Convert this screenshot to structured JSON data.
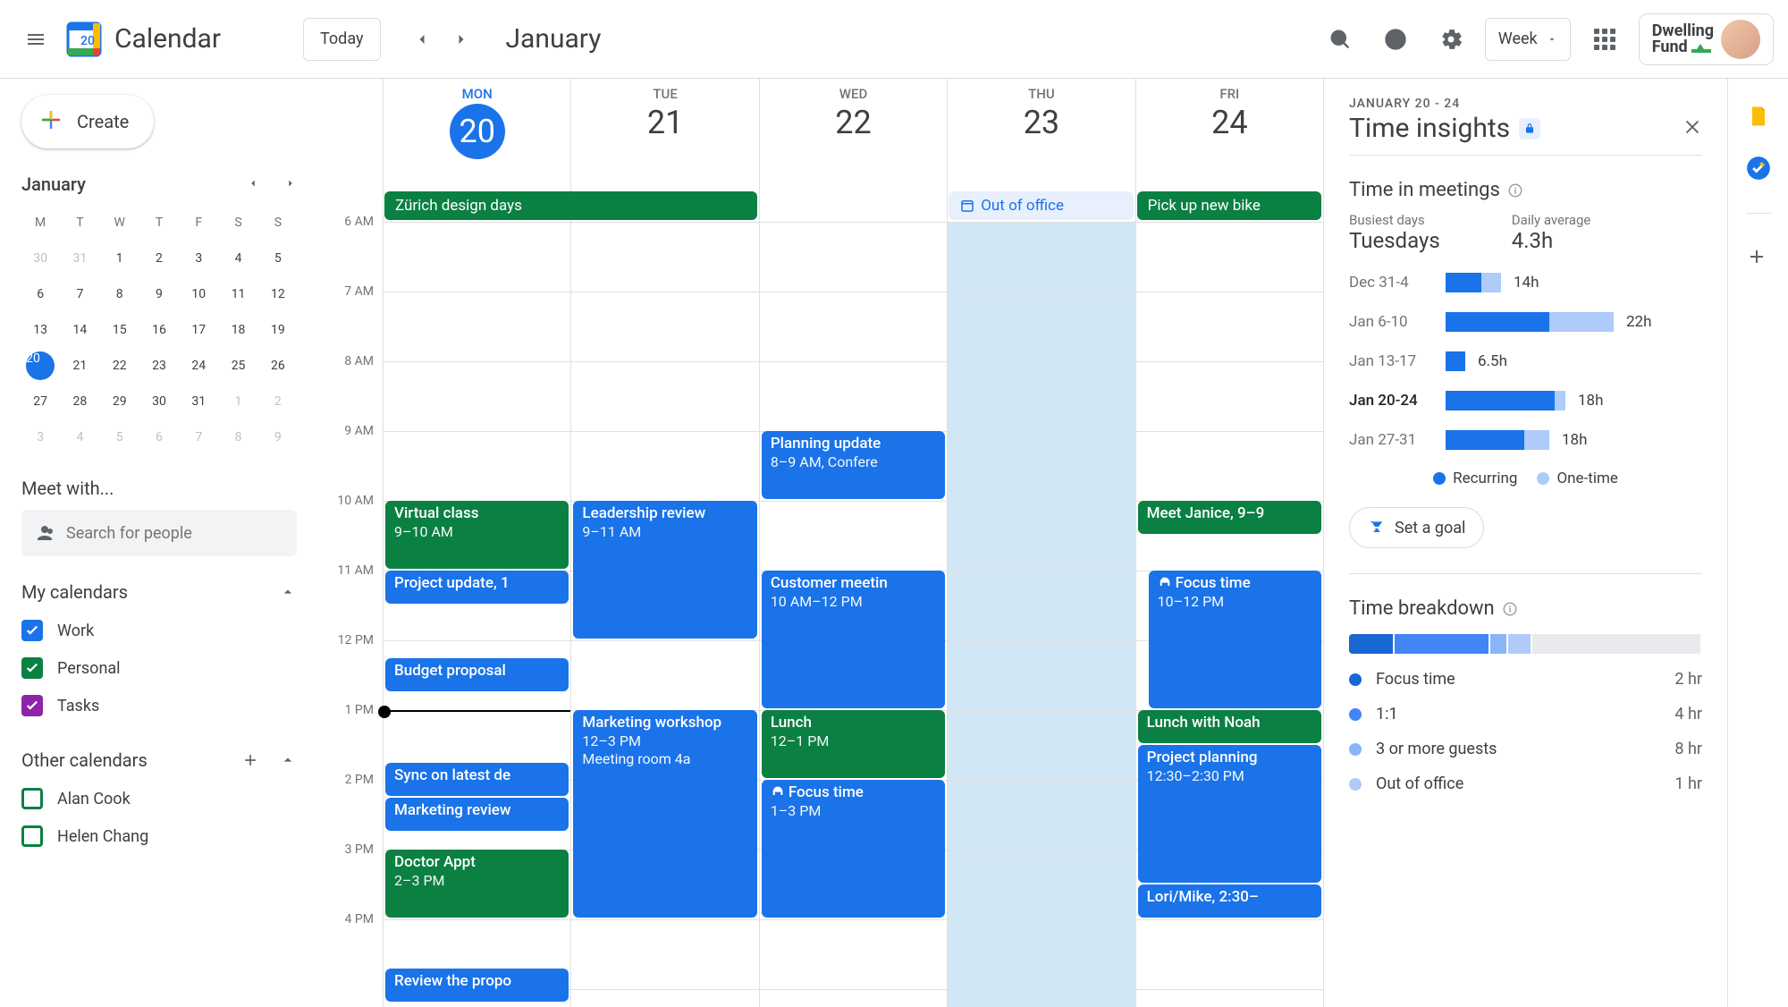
{
  "app": {
    "title": "Calendar"
  },
  "header": {
    "today_label": "Today",
    "month_title": "January",
    "view": "Week",
    "org": "Dwelling\nFund"
  },
  "create_label": "Create",
  "mini_calendar": {
    "month": "January",
    "dow": [
      "M",
      "T",
      "W",
      "T",
      "F",
      "S",
      "S"
    ],
    "weeks": [
      [
        {
          "n": 30,
          "other": true
        },
        {
          "n": 31,
          "other": true
        },
        {
          "n": 1
        },
        {
          "n": 2
        },
        {
          "n": 3
        },
        {
          "n": 4
        },
        {
          "n": 5
        }
      ],
      [
        {
          "n": 6
        },
        {
          "n": 7
        },
        {
          "n": 8
        },
        {
          "n": 9
        },
        {
          "n": 10
        },
        {
          "n": 11
        },
        {
          "n": 12
        }
      ],
      [
        {
          "n": 13
        },
        {
          "n": 14
        },
        {
          "n": 15
        },
        {
          "n": 16
        },
        {
          "n": 17
        },
        {
          "n": 18
        },
        {
          "n": 19
        }
      ],
      [
        {
          "n": 20,
          "selected": true
        },
        {
          "n": 21
        },
        {
          "n": 22
        },
        {
          "n": 23
        },
        {
          "n": 24
        },
        {
          "n": 25
        },
        {
          "n": 26
        }
      ],
      [
        {
          "n": 27
        },
        {
          "n": 28
        },
        {
          "n": 29
        },
        {
          "n": 30
        },
        {
          "n": 31
        },
        {
          "n": 1,
          "other": true
        },
        {
          "n": 2,
          "other": true
        }
      ],
      [
        {
          "n": 3,
          "other": true
        },
        {
          "n": 4,
          "other": true
        },
        {
          "n": 5,
          "other": true
        },
        {
          "n": 6,
          "other": true
        },
        {
          "n": 7,
          "other": true
        },
        {
          "n": 8,
          "other": true
        },
        {
          "n": 9,
          "other": true
        }
      ]
    ]
  },
  "meet_with": {
    "title": "Meet with...",
    "placeholder": "Search for people"
  },
  "my_calendars": {
    "title": "My calendars",
    "items": [
      {
        "label": "Work",
        "color": "#1a73e8",
        "checked": true
      },
      {
        "label": "Personal",
        "color": "#0b8043",
        "checked": true
      },
      {
        "label": "Tasks",
        "color": "#8e24aa",
        "checked": true
      }
    ]
  },
  "other_calendars": {
    "title": "Other calendars",
    "items": [
      {
        "label": "Alan Cook",
        "color": "#0b8043",
        "checked": false
      },
      {
        "label": "Helen Chang",
        "color": "#0b8043",
        "checked": false
      }
    ]
  },
  "days": [
    {
      "dow": "MON",
      "num": 20,
      "selected": true
    },
    {
      "dow": "TUE",
      "num": 21
    },
    {
      "dow": "WED",
      "num": 22
    },
    {
      "dow": "THU",
      "num": 23,
      "ooo": true
    },
    {
      "dow": "FRI",
      "num": 24
    }
  ],
  "time_labels": [
    "6 AM",
    "7 AM",
    "8 AM",
    "9 AM",
    "10 AM",
    "11 AM",
    "12 PM",
    "1 PM",
    "2 PM",
    "3 PM",
    "4 PM"
  ],
  "allday": [
    {
      "day": 0,
      "span": 2,
      "title": "Zürich design days",
      "color": "#0b8043"
    },
    {
      "day": 3,
      "span": 1,
      "title": "Out of office",
      "color": "#e8f0fe",
      "textColor": "#1a73e8",
      "icon": "clock-off"
    },
    {
      "day": 4,
      "span": 1,
      "title": "Pick up new bike",
      "color": "#0b8043"
    }
  ],
  "events": [
    {
      "day": 0,
      "start": 9,
      "end": 10,
      "title": "Virtual class",
      "sub": "9–10 AM",
      "color": "#0b8043"
    },
    {
      "day": 0,
      "start": 10,
      "end": 10.5,
      "title": "Project update, 1",
      "color": "#1a73e8"
    },
    {
      "day": 0,
      "start": 11.25,
      "end": 11.75,
      "title": "Budget proposal",
      "color": "#1a73e8"
    },
    {
      "day": 0,
      "start": 12.75,
      "end": 13.25,
      "title": "Sync on latest de",
      "color": "#1a73e8"
    },
    {
      "day": 0,
      "start": 13.25,
      "end": 13.75,
      "title": "Marketing review",
      "color": "#1a73e8"
    },
    {
      "day": 0,
      "start": 14,
      "end": 15,
      "title": "Doctor Appt",
      "sub": "2–3 PM",
      "color": "#0b8043"
    },
    {
      "day": 0,
      "start": 15.7,
      "end": 16.2,
      "title": "Review the propo",
      "color": "#1a73e8"
    },
    {
      "day": 1,
      "start": 9,
      "end": 11,
      "title": "Leadership review",
      "sub": "9–11  AM",
      "color": "#1a73e8"
    },
    {
      "day": 1,
      "start": 12,
      "end": 15,
      "title": "Marketing workshop",
      "sub": "12–3 PM",
      "sub2": "Meeting room 4a",
      "color": "#1a73e8"
    },
    {
      "day": 2,
      "start": 8,
      "end": 9,
      "title": "Planning update",
      "sub": "8–9 AM, Confere",
      "color": "#1a73e8"
    },
    {
      "day": 2,
      "start": 10,
      "end": 12,
      "title": "Customer meetin",
      "sub": "10 AM–12 PM",
      "color": "#1a73e8"
    },
    {
      "day": 2,
      "start": 12,
      "end": 13,
      "title": "Lunch",
      "sub": "12–1 PM",
      "color": "#0b8043"
    },
    {
      "day": 2,
      "start": 13,
      "end": 15,
      "title": "Focus time",
      "sub": "1–3 PM",
      "color": "#1a73e8",
      "icon": "headphones"
    },
    {
      "day": 4,
      "start": 9,
      "end": 9.5,
      "title": "Meet Janice, 9–9",
      "color": "#0b8043"
    },
    {
      "day": 4,
      "start": 10,
      "end": 12,
      "title": "Focus time",
      "sub": "10–12 PM",
      "color": "#1a73e8",
      "icon": "headphones",
      "indent": true
    },
    {
      "day": 4,
      "start": 12,
      "end": 12.5,
      "title": "Lunch with Noah",
      "color": "#0b8043"
    },
    {
      "day": 4,
      "start": 12.5,
      "end": 14.5,
      "title": "Project planning",
      "sub": "12:30–2:30 PM",
      "color": "#1a73e8"
    },
    {
      "day": 4,
      "start": 14.5,
      "end": 15,
      "title": "Lori/Mike, 2:30–",
      "color": "#1a73e8"
    }
  ],
  "now_hour": 12,
  "insights": {
    "range": "JANUARY 20 - 24",
    "title": "Time insights",
    "time_in_meetings": "Time in meetings",
    "busiest_label": "Busiest days",
    "busiest_val": "Tuesdays",
    "daily_label": "Daily average",
    "daily_val": "4.3h",
    "bars": [
      {
        "label": "Dec 31-4",
        "recurring": 40,
        "onetime": 22,
        "val": "14h"
      },
      {
        "label": "Jan 6-10",
        "recurring": 116,
        "onetime": 72,
        "val": "22h"
      },
      {
        "label": "Jan 13-17",
        "recurring": 22,
        "onetime": 0,
        "val": "6.5h"
      },
      {
        "label": "Jan 20-24",
        "recurring": 122,
        "onetime": 12,
        "val": "18h",
        "current": true
      },
      {
        "label": "Jan 27-31",
        "recurring": 88,
        "onetime": 28,
        "val": "18h"
      }
    ],
    "legend_recurring": "Recurring",
    "legend_onetime": "One-time",
    "goal_label": "Set a goal",
    "breakdown_title": "Time breakdown",
    "breakdown_bar": [
      {
        "w": 13,
        "c": "#1967d2"
      },
      {
        "w": 27,
        "c": "#4285f4"
      },
      {
        "w": 5,
        "c": "#8ab4f8"
      },
      {
        "w": 7,
        "c": "#aecbfa"
      },
      {
        "w": 48,
        "c": "#e8eaed"
      }
    ],
    "breakdown_items": [
      {
        "label": "Focus time",
        "val": "2 hr",
        "c": "#1967d2"
      },
      {
        "label": "1:1",
        "val": "4 hr",
        "c": "#4285f4"
      },
      {
        "label": "3 or more guests",
        "val": "8 hr",
        "c": "#8ab4f8"
      },
      {
        "label": "Out of office",
        "val": "1 hr",
        "c": "#aecbfa"
      }
    ]
  },
  "colors": {
    "blue": "#1a73e8",
    "green": "#0b8043",
    "lightblue": "#8ab4f8"
  }
}
